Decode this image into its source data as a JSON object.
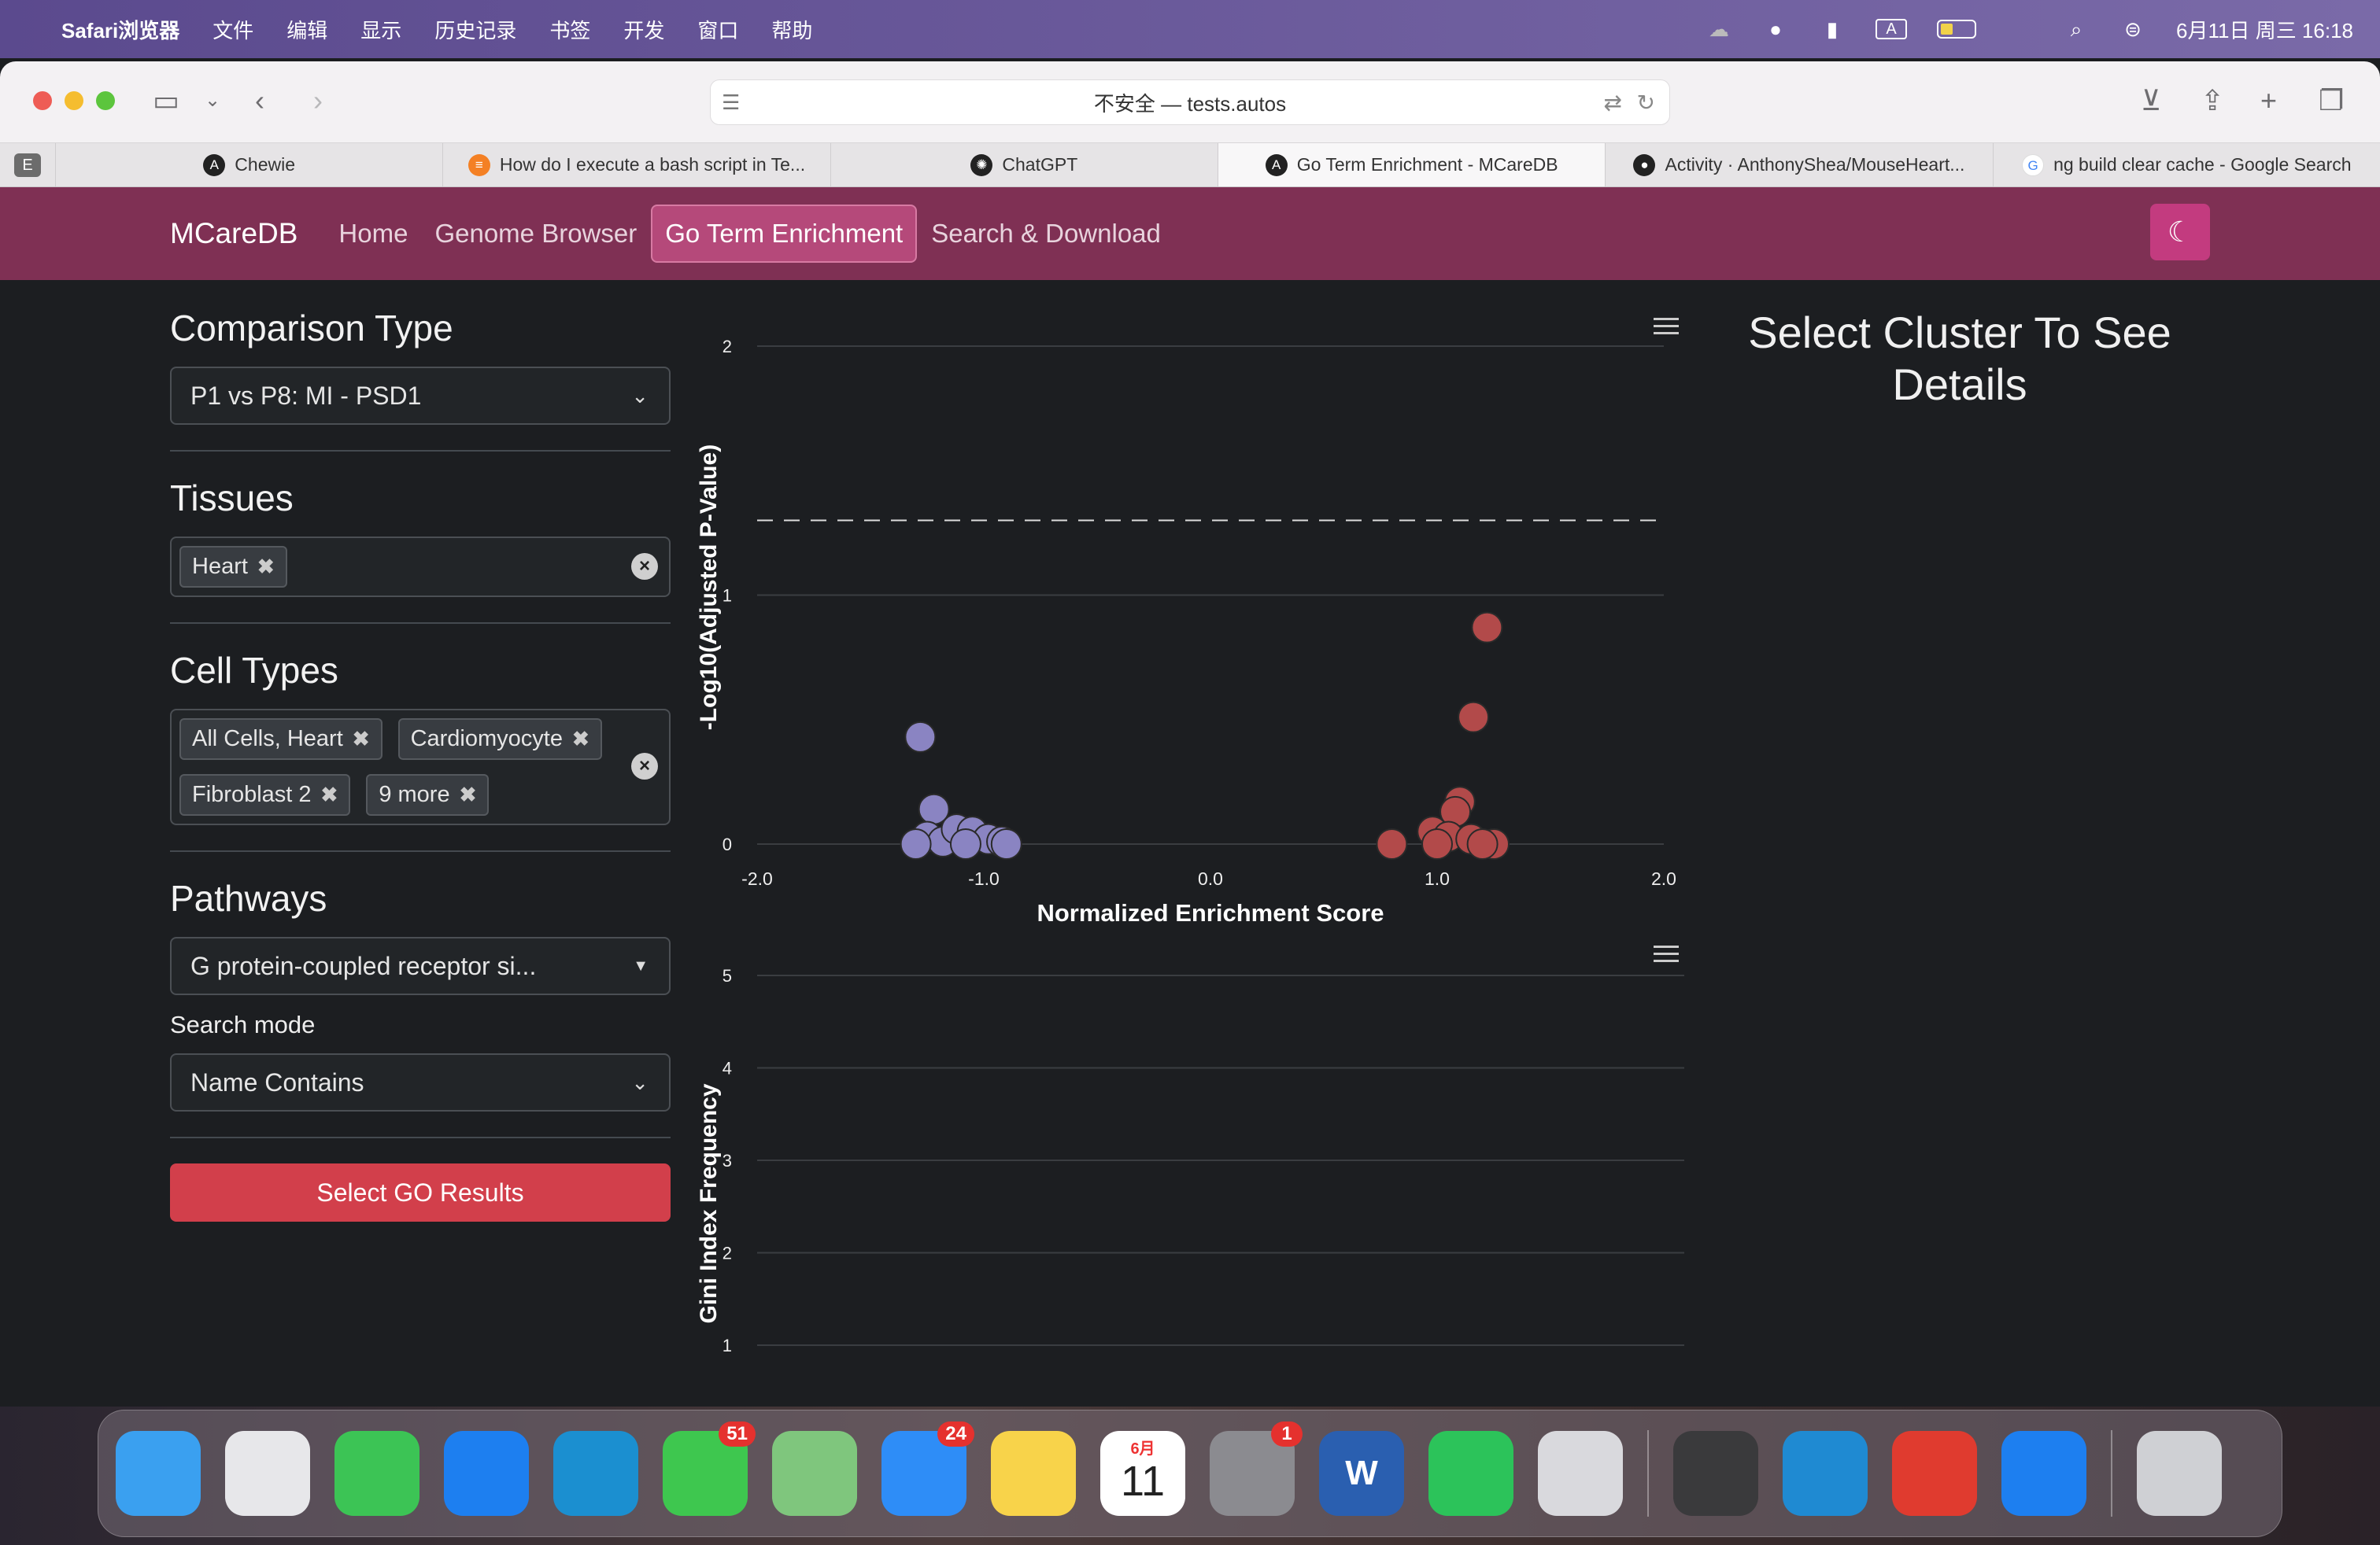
{
  "menubar": {
    "app": "Safari浏览器",
    "items": [
      "文件",
      "编辑",
      "显示",
      "历史记录",
      "书签",
      "开发",
      "窗口",
      "帮助"
    ],
    "clock": "6月11日 周三  16:18",
    "input_badge": "A",
    "battery_level": 0.35
  },
  "browser": {
    "address": "不安全 — tests.autos",
    "tabs": [
      {
        "label": "Chewie",
        "icon": "angular-icon"
      },
      {
        "label": "How do I execute a bash script in Te...",
        "icon": "stackoverflow-icon"
      },
      {
        "label": "ChatGPT",
        "icon": "chatgpt-icon"
      },
      {
        "label": "Go Term Enrichment - MCareDB",
        "icon": "angular-icon",
        "active": true
      },
      {
        "label": "Activity · AnthonyShea/MouseHeart...",
        "icon": "github-icon"
      },
      {
        "label": "ng build clear cache - Google Search",
        "icon": "google-icon"
      }
    ]
  },
  "nav": {
    "brand": "MCareDB",
    "links": [
      "Home",
      "Genome Browser",
      "Go Term Enrichment",
      "Search & Download"
    ],
    "active": "Go Term Enrichment"
  },
  "sidebar": {
    "comparison": {
      "title": "Comparison Type",
      "value": "P1 vs P8: MI - PSD1"
    },
    "tissues": {
      "title": "Tissues",
      "chips": [
        "Heart"
      ]
    },
    "cell_types": {
      "title": "Cell Types",
      "chips": [
        "All Cells, Heart",
        "Cardiomyocyte",
        "Fibroblast 2",
        "9 more"
      ]
    },
    "pathways": {
      "title": "Pathways",
      "value": "G protein-coupled receptor si..."
    },
    "search_mode": {
      "label": "Search mode",
      "value": "Name Contains"
    },
    "submit": "Select GO Results"
  },
  "detail": {
    "title": "Select Cluster To See Details"
  },
  "colors": {
    "nav": "#7f3054",
    "accent": "#c33b7f",
    "button": "#d23f4b",
    "negative": "#8a84c2",
    "positive": "#b24a4a"
  },
  "chart_data": [
    {
      "type": "scatter",
      "xlabel": "Normalized Enrichment Score",
      "ylabel": "-Log10(Adjusted P-Value)",
      "xlim": [
        -2,
        2
      ],
      "ylim": [
        0,
        2
      ],
      "xticks": [
        "-2.0",
        "-1.0",
        "0.0",
        "1.0",
        "2.0"
      ],
      "yticks": [
        "0",
        "1",
        "2"
      ],
      "threshold": 1.3,
      "grid": true,
      "series": [
        {
          "color": "#8a84c2",
          "points": [
            [
              -1.28,
              0.43
            ],
            [
              -1.22,
              0.14
            ],
            [
              -1.25,
              0.03
            ],
            [
              -1.18,
              0.01
            ],
            [
              -1.12,
              0.06
            ],
            [
              -1.05,
              0.05
            ],
            [
              -0.98,
              0.02
            ],
            [
              -0.92,
              0.01
            ],
            [
              -1.3,
              0.0
            ],
            [
              -1.08,
              0.0
            ],
            [
              -0.9,
              0.0
            ]
          ]
        },
        {
          "color": "#b24a4a",
          "points": [
            [
              1.22,
              0.87
            ],
            [
              1.16,
              0.51
            ],
            [
              1.1,
              0.17
            ],
            [
              1.08,
              0.13
            ],
            [
              0.98,
              0.05
            ],
            [
              1.05,
              0.03
            ],
            [
              1.15,
              0.02
            ],
            [
              1.25,
              0.0
            ],
            [
              0.8,
              0.0
            ],
            [
              1.0,
              0.0
            ],
            [
              1.2,
              0.0
            ]
          ]
        }
      ]
    },
    {
      "type": "bar",
      "ylabel": "Gini Index Frequency",
      "yticks": [
        "1",
        "2",
        "3",
        "4",
        "5"
      ],
      "ylim": [
        1,
        5
      ],
      "grid": true
    }
  ],
  "dock": [
    {
      "name": "finder-icon",
      "color": "#3aa0f0"
    },
    {
      "name": "launchpad-icon",
      "color": "#e7e7ea"
    },
    {
      "name": "facetime-icon",
      "color": "#3cc455"
    },
    {
      "name": "safari-icon",
      "color": "#1d7ff0"
    },
    {
      "name": "edge-icon",
      "color": "#1b8fd0"
    },
    {
      "name": "messages-icon",
      "color": "#3ec74f",
      "badge": "51"
    },
    {
      "name": "maps-icon",
      "color": "#7fc67d"
    },
    {
      "name": "mail-icon",
      "color": "#2e8df7",
      "badge": "24"
    },
    {
      "name": "notes-icon",
      "color": "#f8d34a"
    },
    {
      "name": "calendar-icon",
      "color": "#ffffff",
      "label": "11",
      "month": "6月"
    },
    {
      "name": "system-settings-icon",
      "color": "#8b8b90",
      "badge": "1"
    },
    {
      "name": "word-icon",
      "color": "#2a5fb0",
      "label": "W"
    },
    {
      "name": "wechat-icon",
      "color": "#2cc35a"
    },
    {
      "name": "iphone-mirroring-icon",
      "color": "#d9d9dd"
    },
    {
      "name": "calculator-icon",
      "color": "#3a3a3c"
    },
    {
      "name": "vscode-icon",
      "color": "#1f8ad2"
    },
    {
      "name": "wps-icon",
      "color": "#e03b2f"
    },
    {
      "name": "safari-technology-preview-icon",
      "color": "#1d7ff0"
    },
    {
      "name": "trash-icon",
      "color": "#cfd0d4"
    }
  ]
}
